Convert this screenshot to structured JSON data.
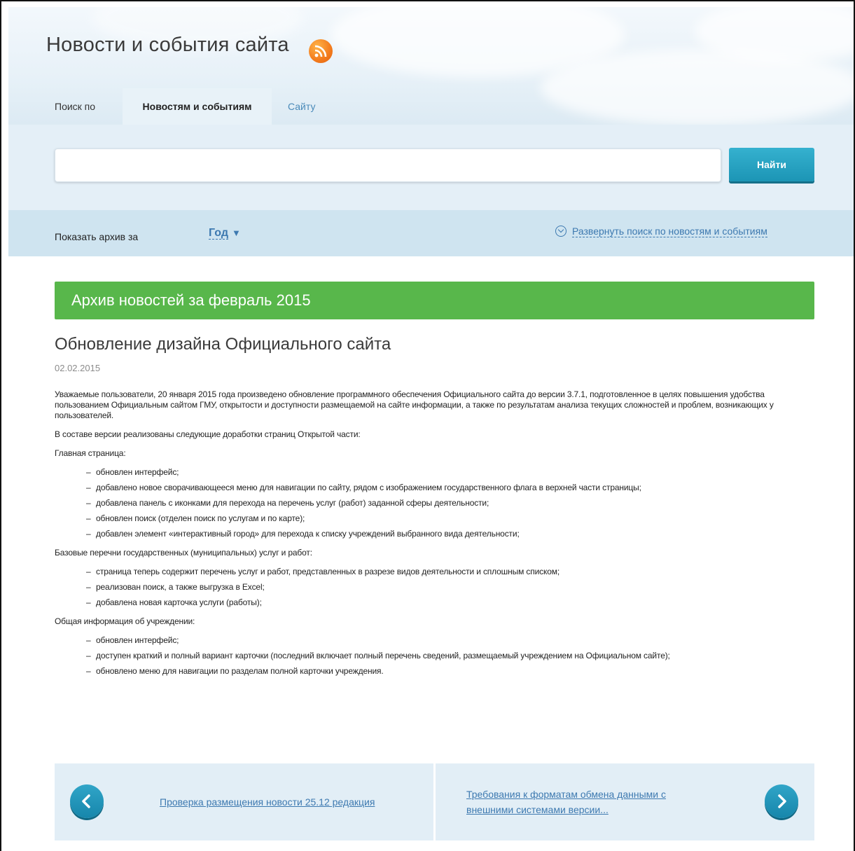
{
  "header": {
    "title": "Новости и события сайта",
    "rss_icon": "rss-icon",
    "search_tabs": {
      "label": "Поиск по",
      "active": "Новостям и событиям",
      "other": "Сайту"
    }
  },
  "search": {
    "value": "",
    "button_label": "Найти"
  },
  "archive_filter": {
    "label": "Показать архив за",
    "period": "Год",
    "expand_link": "Развернуть поиск по новостям и событиям"
  },
  "archive_heading": "Архив новостей за февраль 2015",
  "article": {
    "title": "Обновление дизайна Официального сайта",
    "date": "02.02.2015",
    "intro": "Уважаемые пользователи, 20 января 2015 года произведено обновление программного обеспечения Официального сайта до версии 3.7.1, подготовленное в целях повышения удобства пользованием Официальным сайтом ГМУ, открытости и доступности размещаемой на сайте информации, а также по результатам анализа текущих сложностей и проблем, возникающих у пользователей.",
    "versions_text": "В составе версии реализованы следующие доработки страниц Открытой части:",
    "sections": [
      {
        "heading": "Главная страница:",
        "items": [
          "обновлен интерфейс;",
          "добавлено новое сворачивающееся меню для навигации по сайту, рядом с изображением государственного флага в верхней части страницы;",
          "добавлена панель с иконками для перехода на перечень услуг (работ) заданной сферы деятельности;",
          "обновлен поиск (отделен поиск по услугам и по карте);",
          "добавлен элемент «интерактивный город» для перехода к списку учреждений выбранного вида деятельности;"
        ]
      },
      {
        "heading": "Базовые перечни государственных (муниципальных) услуг и работ:",
        "items": [
          "страница теперь содержит перечень услуг и работ, представленных в разрезе видов деятельности и сплошным списком;",
          "реализован поиск, а также выгрузка в Excel;",
          "добавлена новая карточка услуги (работы);"
        ]
      },
      {
        "heading": "Общая информация об учреждении:",
        "items": [
          "обновлен интерфейс;",
          "доступен краткий и полный вариант карточки (последний включает полный перечень сведений, размещаемый учреждением на Официальном сайте);",
          "обновлено меню для навигации по разделам полной карточки учреждения."
        ]
      }
    ]
  },
  "pager": {
    "prev_icon": "chevron-left-icon",
    "prev_title": "Проверка размещения новости 25.12 редакция",
    "next_icon": "chevron-right-icon",
    "next_title_line1": "Требования к форматам обмена данными с",
    "next_title_line2": "внешними системами версии..."
  },
  "colors": {
    "accent_blue": "#3d79b0",
    "button_teal": "#1c95b5",
    "archive_green": "#58b74b",
    "rss_orange": "#f37b1d"
  }
}
